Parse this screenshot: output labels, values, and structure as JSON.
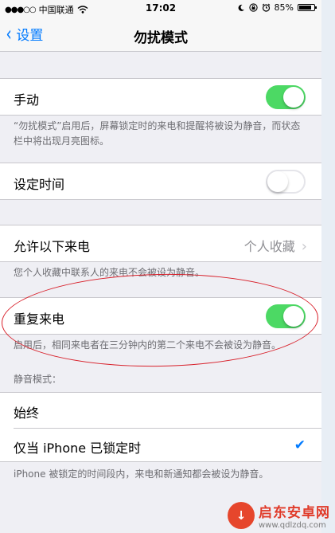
{
  "status_bar": {
    "carrier": "中国联通",
    "signal_dots": "●●●○○",
    "wifi_icon": "wifi-icon",
    "time": "17:02",
    "moon_icon": "moon-icon",
    "lock_rotation_icon": "lock-rotation-icon",
    "alarm_icon": "alarm-icon",
    "battery": "85%",
    "battery_level": 0.85
  },
  "nav": {
    "back_label": "设置",
    "title": "勿扰模式"
  },
  "sections": {
    "manual": {
      "label": "手动",
      "toggle_on": true,
      "footer": "“勿扰模式”启用后，屏幕锁定时的来电和提醒将被设为静音，而状态栏中将出现月亮图标。"
    },
    "scheduled": {
      "label": "设定时间",
      "toggle_on": false
    },
    "allow_calls": {
      "label": "允许以下来电",
      "value": "个人收藏",
      "footer": "您个人收藏中联系人的来电不会被设为静音。"
    },
    "repeated_calls": {
      "label": "重复来电",
      "toggle_on": true,
      "footer": "启用后，相同来电者在三分钟内的第二个来电不会被设为静音。"
    },
    "silence": {
      "header": "静音模式：",
      "options": [
        {
          "label": "始终",
          "selected": false
        },
        {
          "label": "仅当 iPhone 已锁定时",
          "selected": true
        }
      ],
      "footer": "iPhone 被锁定的时间段内，来电和新通知都会被设为静音。"
    }
  },
  "watermark": {
    "title": "启东安卓网",
    "url": "www.qdlzdq.com"
  },
  "colors": {
    "accent": "#007aff",
    "toggle_on": "#4cd964",
    "annotation": "#d8202a"
  }
}
